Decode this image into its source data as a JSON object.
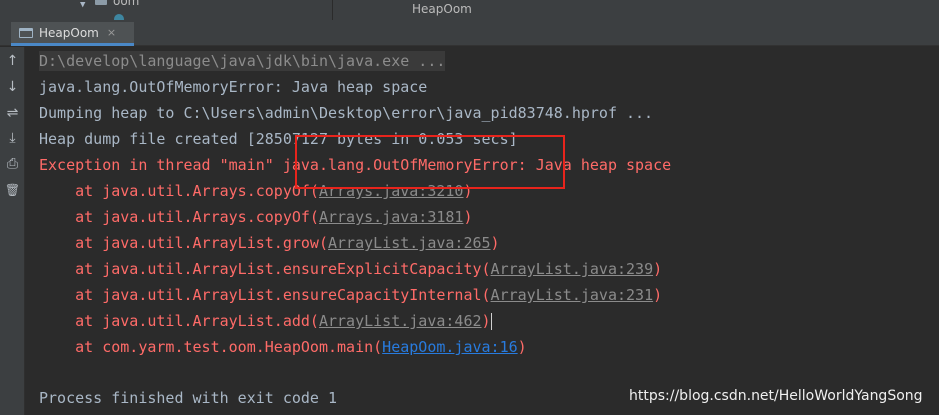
{
  "project_tree": {
    "folder_label": "oom"
  },
  "editor": {
    "title": "HeapOom"
  },
  "run_tab": {
    "label": "HeapOom",
    "close": "×"
  },
  "toolbar": [
    {
      "name": "up-arrow-icon",
      "glyph": "↑"
    },
    {
      "name": "down-arrow-icon",
      "glyph": "↓"
    },
    {
      "name": "soft-wrap-icon",
      "glyph": "⇌"
    },
    {
      "name": "scroll-to-end-icon",
      "glyph": "⤓"
    },
    {
      "name": "print-icon",
      "glyph": "⎙"
    },
    {
      "name": "trash-icon",
      "glyph": "🗑"
    }
  ],
  "console": {
    "command": "D:\\develop\\language\\java\\jdk\\bin\\java.exe ...",
    "oom_line": "java.lang.OutOfMemoryError: Java heap space",
    "dumping": "Dumping heap to C:\\Users\\admin\\Desktop\\error\\java_pid83748.hprof ...",
    "dump_created": "Heap dump file created [28507127 bytes in 0.053 secs]",
    "exception": "Exception in thread \"main\" java.lang.OutOfMemoryError: Java heap space",
    "stack": [
      {
        "prefix": "\tat java.util.Arrays.copyOf(",
        "link": "Arrays.java:3210",
        "suffix": ")"
      },
      {
        "prefix": "\tat java.util.Arrays.copyOf(",
        "link": "Arrays.java:3181",
        "suffix": ")"
      },
      {
        "prefix": "\tat java.util.ArrayList.grow(",
        "link": "ArrayList.java:265",
        "suffix": ")"
      },
      {
        "prefix": "\tat java.util.ArrayList.ensureExplicitCapacity(",
        "link": "ArrayList.java:239",
        "suffix": ")"
      },
      {
        "prefix": "\tat java.util.ArrayList.ensureCapacityInternal(",
        "link": "ArrayList.java:231",
        "suffix": ")"
      },
      {
        "prefix": "\tat java.util.ArrayList.add(",
        "link": "ArrayList.java:462",
        "suffix": ")"
      },
      {
        "prefix": "\tat com.yarm.test.oom.HeapOom.main(",
        "link": "HeapOom.java:16",
        "suffix": ")"
      }
    ],
    "exit": "Process finished with exit code 1"
  },
  "watermark": "https://blog.csdn.net/HelloWorldYangSong",
  "colors": {
    "background": "#2b2b2b",
    "panel": "#3c3f41",
    "error_text": "#ff6b68",
    "normal_text": "#a9b7c6",
    "user_link": "#287bde",
    "highlight_box": "#e8241c"
  }
}
